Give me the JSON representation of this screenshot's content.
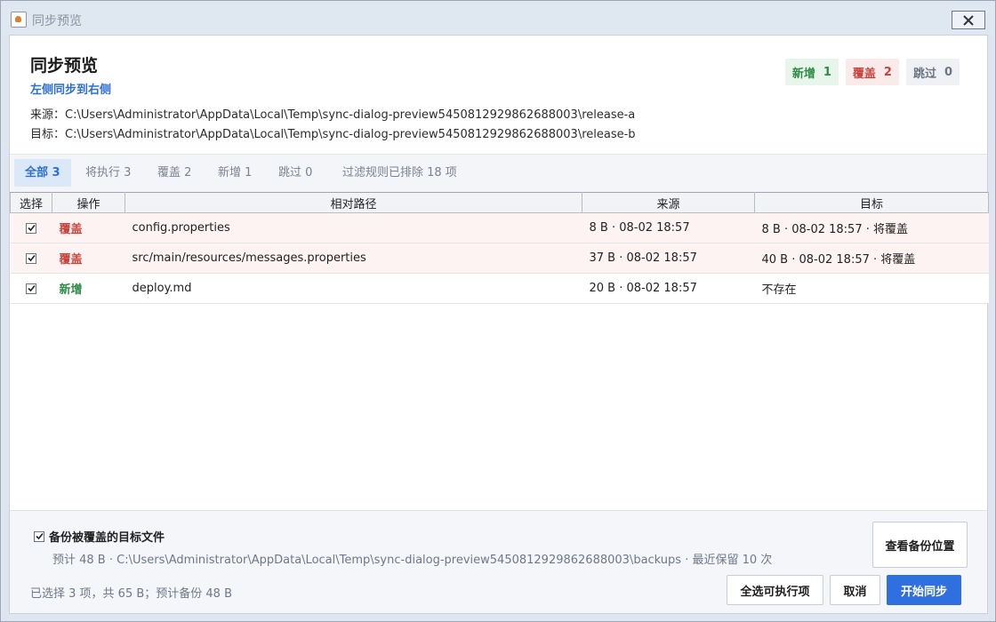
{
  "window": {
    "title": "同步预览"
  },
  "header": {
    "title": "同步预览",
    "subtitle": "左侧同步到右侧",
    "source_label": "来源：",
    "source_path": "C:\\Users\\Administrator\\AppData\\Local\\Temp\\sync-dialog-preview5450812929862688003\\release-a",
    "target_label": "目标：",
    "target_path": "C:\\Users\\Administrator\\AppData\\Local\\Temp\\sync-dialog-preview5450812929862688003\\release-b"
  },
  "badges": [
    {
      "label": "新增",
      "count": "1",
      "color": "#2f8a46"
    },
    {
      "label": "覆盖",
      "count": "2",
      "color": "#c8443b"
    },
    {
      "label": "跳过",
      "count": "0",
      "color": "#6d7684"
    }
  ],
  "tabs": [
    {
      "label": "全部 3",
      "active": true
    },
    {
      "label": "将执行 3"
    },
    {
      "label": "覆盖 2"
    },
    {
      "label": "新增 1"
    },
    {
      "label": "跳过 0"
    },
    {
      "label": "过滤规则已排除 18 项"
    }
  ],
  "table": {
    "headers": [
      "选择",
      "操作",
      "相对路径",
      "来源",
      "目标"
    ],
    "rows": [
      {
        "checked": true,
        "action": "覆盖",
        "path": "config.properties",
        "source": "8 B · 08-02 18:57",
        "target": "8 B · 08-02 18:57 · 将覆盖"
      },
      {
        "checked": true,
        "action": "覆盖",
        "path": "src/main/resources/messages.properties",
        "source": "37 B · 08-02 18:57",
        "target": "40 B · 08-02 18:57 · 将覆盖"
      },
      {
        "checked": true,
        "action": "新增",
        "path": "deploy.md",
        "source": "20 B · 08-02 18:57",
        "target": "不存在"
      }
    ]
  },
  "footer": {
    "backup_label": "备份被覆盖的目标文件",
    "backup_checked": true,
    "backup_info": "预计 48 B · C:\\Users\\Administrator\\AppData\\Local\\Temp\\sync-dialog-preview5450812929862688003\\backups · 最近保留 10 次",
    "summary": "已选择 3 项，共 65 B；预计备份 48 B",
    "view_backup_label": "查看备份位置",
    "select_all_label": "全选可执行项",
    "cancel_label": "取消",
    "start_label": "开始同步"
  },
  "colors": {
    "accent": "#2f6fe0",
    "overwrite": "#c8443b",
    "add": "#2f8a46"
  }
}
